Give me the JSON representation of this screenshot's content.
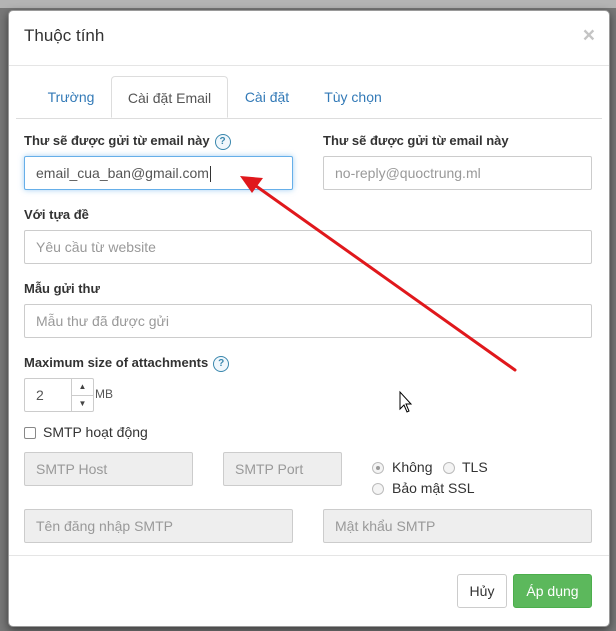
{
  "dialog": {
    "title": "Thuộc tính",
    "close_glyph": "×"
  },
  "tabs": [
    {
      "label": "Trường",
      "active": false
    },
    {
      "label": "Cài đặt Email",
      "active": true
    },
    {
      "label": "Cài đặt",
      "active": false
    },
    {
      "label": "Tùy chọn",
      "active": false
    }
  ],
  "form": {
    "from_email": {
      "label": "Thư sẽ được gửi từ email này",
      "help": "?",
      "value": "email_cua_ban@gmail.com"
    },
    "reply_email": {
      "label": "Thư sẽ được gửi từ email này",
      "placeholder": "no-reply@quoctrung.ml"
    },
    "subject": {
      "label": "Với tựa đề",
      "placeholder": "Yêu cầu từ website"
    },
    "template": {
      "label": "Mẫu gửi thư",
      "placeholder": "Mẫu thư đã được gửi"
    },
    "max_size": {
      "label": "Maximum size of attachments",
      "help": "?",
      "value": "2",
      "unit": "MB",
      "up": "▲",
      "down": "▼"
    },
    "smtp_active": {
      "label": "SMTP hoạt động",
      "checked": false
    },
    "smtp_host": {
      "placeholder": "SMTP Host"
    },
    "smtp_port": {
      "placeholder": "SMTP Port"
    },
    "security": {
      "options": [
        {
          "label": "Không",
          "selected": true
        },
        {
          "label": "TLS",
          "selected": false
        },
        {
          "label": "Bảo mật SSL",
          "selected": false
        }
      ]
    },
    "smtp_user": {
      "placeholder": "Tên đăng nhập SMTP"
    },
    "smtp_pass": {
      "placeholder": "Mật khẩu SMTP"
    }
  },
  "footer": {
    "cancel_label": "Hủy",
    "apply_label": "Áp dụng"
  },
  "colors": {
    "accent": "#337ab7",
    "success": "#5cb85c",
    "annotation_arrow": "#e0181c"
  },
  "icons": {
    "help": "question-circle-icon",
    "close": "close-icon",
    "cursor": "mouse-pointer-icon"
  }
}
